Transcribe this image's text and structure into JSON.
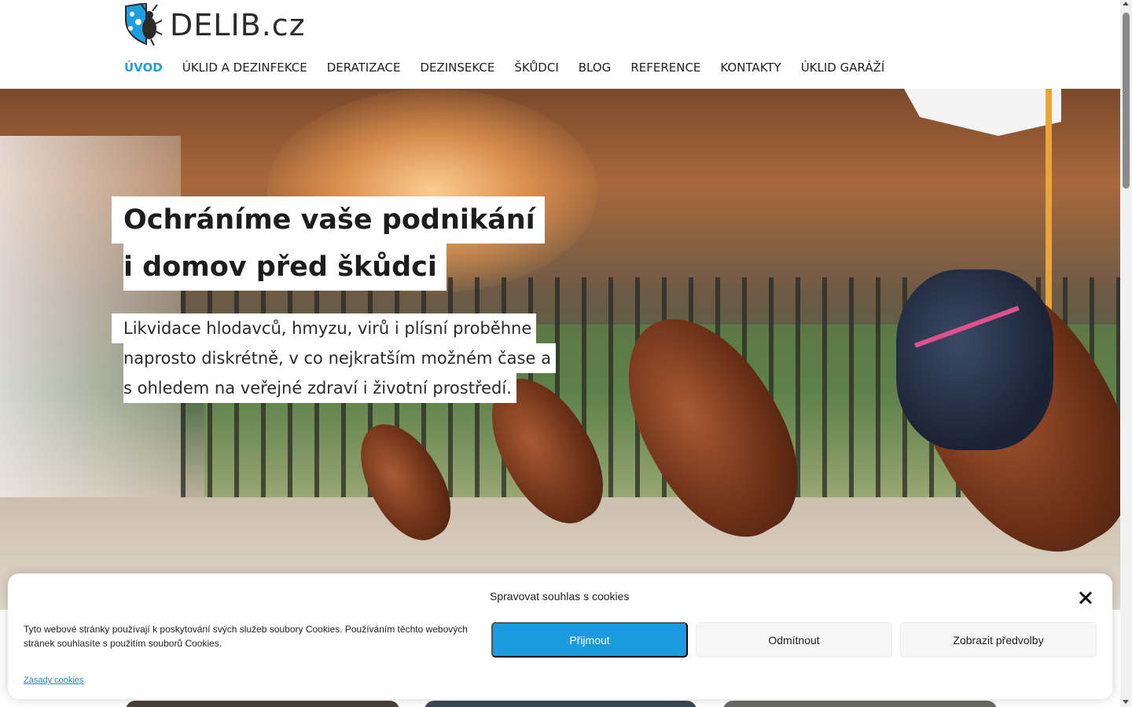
{
  "brand": {
    "name": "DELIB.cz",
    "logo_colors": [
      "#1e9fe0",
      "#2b2b2b"
    ]
  },
  "nav": {
    "items": [
      {
        "label": "ÚVOD",
        "active": true
      },
      {
        "label": "ÚKLID A DEZINFEKCE",
        "active": false
      },
      {
        "label": "DERATIZACE",
        "active": false
      },
      {
        "label": "DEZINSEKCE",
        "active": false
      },
      {
        "label": "ŠKŮDCI",
        "active": false
      },
      {
        "label": "BLOG",
        "active": false
      },
      {
        "label": "REFERENCE",
        "active": false
      },
      {
        "label": "KONTAKTY",
        "active": false
      },
      {
        "label": "ÚKLID GARÁŽÍ",
        "active": false
      }
    ]
  },
  "hero": {
    "headline_line1": "Ochráníme vaše podnikání",
    "headline_line2": "i domov před škůdci",
    "sub_line1": "Likvidace hlodavců, hmyzu, virů i plísní proběhne",
    "sub_line2": "naprosto diskrétně, v co nejkratším možném čase a",
    "sub_line3": "s ohledem na veřejné zdraví i životní prostředí."
  },
  "cookie": {
    "title": "Spravovat souhlas s cookies",
    "text": "Tyto webové stránky používají k poskytování svých služeb soubory Cookies. Používáním těchto webových stránek souhlasíte s použitím souborů Cookies.",
    "policy_link": "Zásady cookies",
    "accept": "Přijmout",
    "deny": "Odmítnout",
    "preferences": "Zobrazit předvolby",
    "accent": "#1a9be0"
  }
}
